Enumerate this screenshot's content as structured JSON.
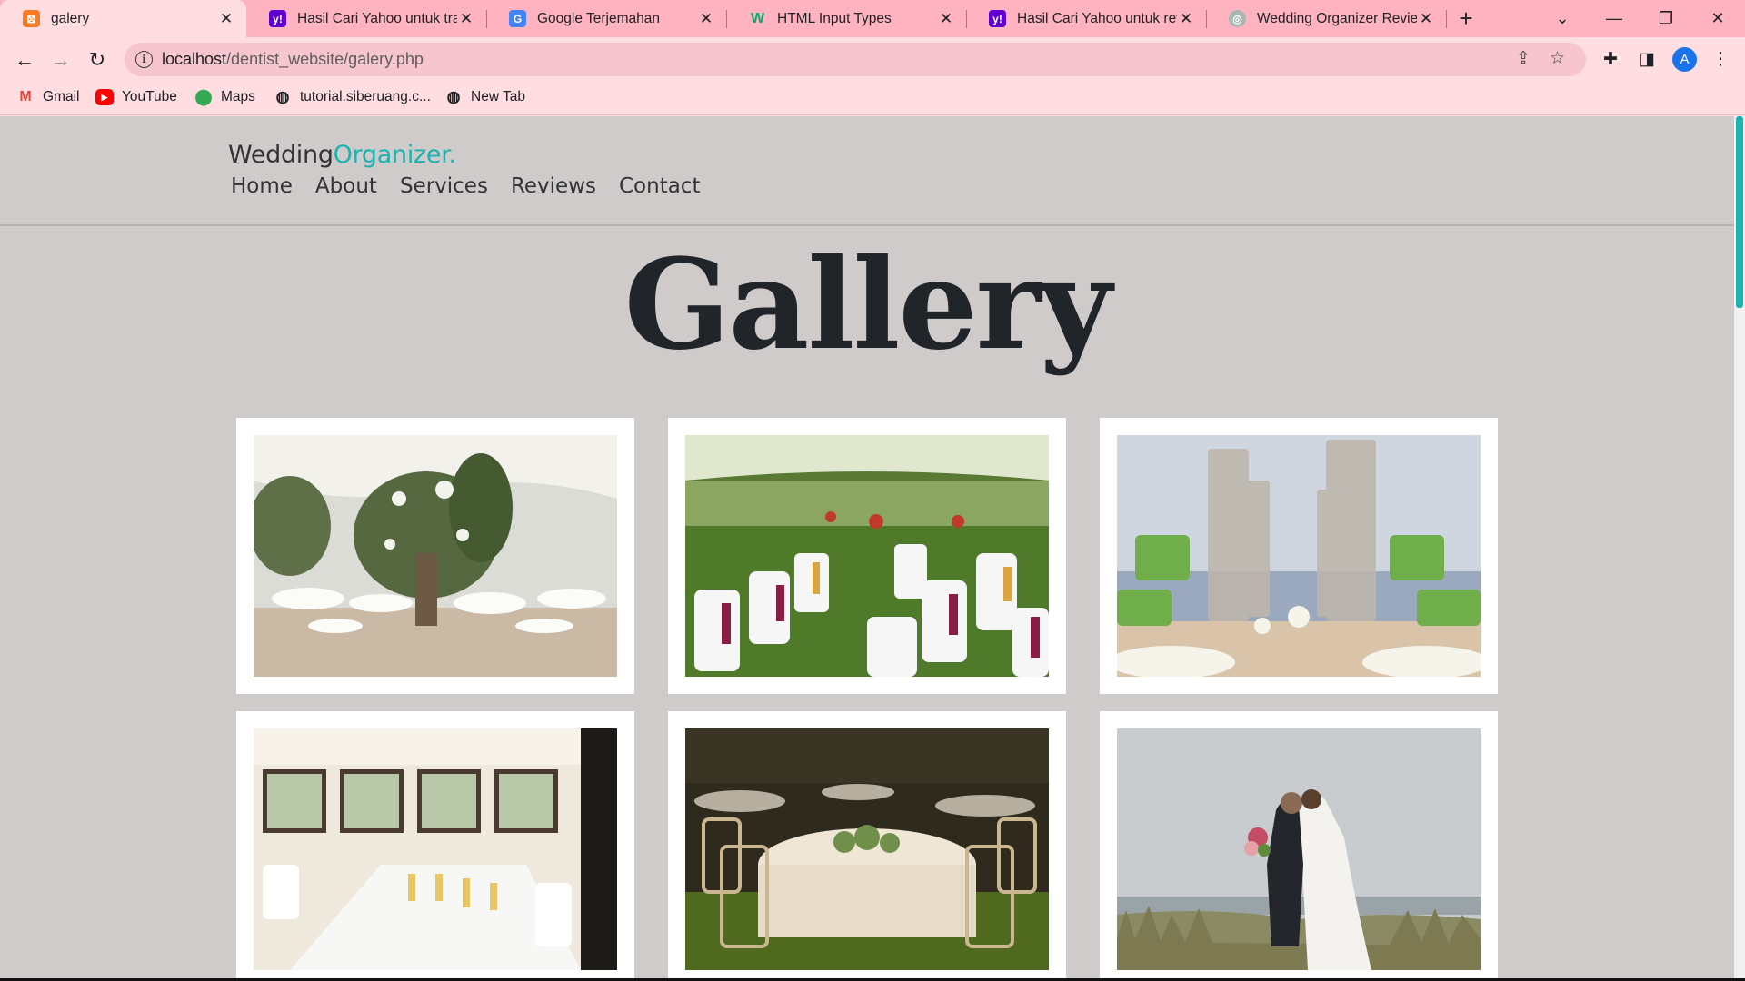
{
  "browser": {
    "tabs": [
      {
        "title": "galery",
        "icon": "xampp-icon",
        "active": true
      },
      {
        "title": "Hasil Cari Yahoo untuk tran",
        "icon": "yahoo-icon",
        "active": false
      },
      {
        "title": "Google Terjemahan",
        "icon": "google-translate-icon",
        "active": false
      },
      {
        "title": "HTML Input Types",
        "icon": "w3schools-icon",
        "active": false
      },
      {
        "title": "Hasil Cari Yahoo untuk revi",
        "icon": "yahoo-icon",
        "active": false
      },
      {
        "title": "Wedding Organizer Review",
        "icon": "chatgpt-icon",
        "active": false
      }
    ],
    "address": {
      "host": "localhost",
      "path": "/dentist_website/galery.php"
    },
    "profile_initial": "A",
    "bookmarks": [
      {
        "label": "Gmail",
        "icon": "gmail-icon"
      },
      {
        "label": "YouTube",
        "icon": "youtube-icon"
      },
      {
        "label": "Maps",
        "icon": "maps-icon"
      },
      {
        "label": "tutorial.siberuang.c...",
        "icon": "globe-icon"
      },
      {
        "label": "New Tab",
        "icon": "globe-icon"
      }
    ]
  },
  "site": {
    "brand": {
      "part1": "Wedding",
      "part2": "Organizer."
    },
    "nav": [
      "Home",
      "About",
      "Services",
      "Reviews",
      "Contact"
    ],
    "heading": "Gallery",
    "gallery": [
      {
        "name": "gallery-photo-tent-reception",
        "subject": "tent reception with floral tree"
      },
      {
        "name": "gallery-photo-garden-chairs",
        "subject": "garden chairs with maroon sashes"
      },
      {
        "name": "gallery-photo-ceremony-arch",
        "subject": "hilltop ceremony arches"
      },
      {
        "name": "gallery-photo-banquet-hall",
        "subject": "banquet hall with window view"
      },
      {
        "name": "gallery-photo-round-table",
        "subject": "round table with chiavari chairs"
      },
      {
        "name": "gallery-photo-couple-dunes",
        "subject": "couple embracing on dunes"
      }
    ],
    "colors": {
      "accent": "#1cb3b0",
      "page_bg": "#cfcbcb",
      "chrome_bg": "#ffdde1",
      "tabstrip_bg": "#ffb3c1"
    }
  }
}
